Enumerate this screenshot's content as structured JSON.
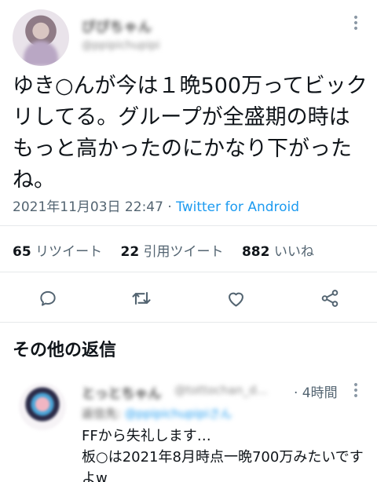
{
  "tweet": {
    "author_name": "ぴぴちゃん",
    "author_handle": "@ppipichupipi",
    "body": "ゆき○んが今は１晩500万ってビックリしてる。グループが全盛期の時はもっと高かったのにかなり下がったね。",
    "timestamp": "2021年11月03日 22:47",
    "separator": " · ",
    "source": "Twitter for Android",
    "stats": [
      {
        "count": "65",
        "label": "リツイート"
      },
      {
        "count": "22",
        "label": "引用ツイート"
      },
      {
        "count": "882",
        "label": "いいね"
      }
    ],
    "actions": [
      "reply-icon",
      "retweet-icon",
      "like-icon",
      "share-icon"
    ],
    "more_icon": "more-vertical-icon"
  },
  "section_title": "その他の返信",
  "reply": {
    "author_name": "とっとちゃん",
    "author_handle": "@tottochan_d...",
    "time": "· 4時間",
    "replying_label": "返信先:",
    "replying_to": "@ppipichupipiさん",
    "text": "FFから失礼します…\n板○は2021年8月時点一晩700万みたいですよw"
  },
  "colors": {
    "link": "#1d9bf0",
    "secondary_text": "#536471",
    "divider": "#e6e9eb"
  }
}
